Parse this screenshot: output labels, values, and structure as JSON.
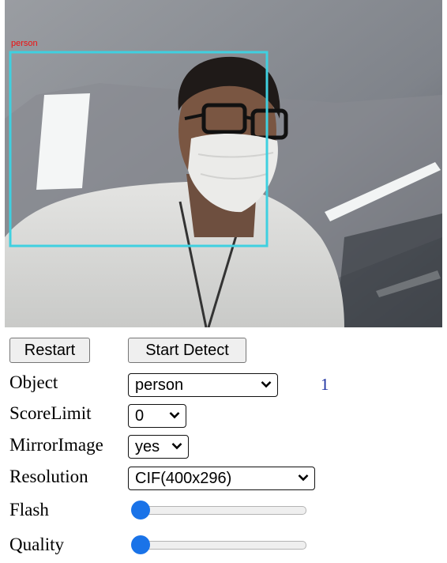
{
  "detection": {
    "label": "person"
  },
  "buttons": {
    "restart": "Restart",
    "start_detect": "Start Detect"
  },
  "object": {
    "label": "Object",
    "value": "person",
    "count": "1"
  },
  "score_limit": {
    "label": "ScoreLimit",
    "value": "0"
  },
  "mirror_image": {
    "label": "MirrorImage",
    "value": "yes"
  },
  "resolution": {
    "label": "Resolution",
    "value": "CIF(400x296)"
  },
  "flash": {
    "label": "Flash",
    "level": 0
  },
  "quality": {
    "label": "Quality",
    "level": 0
  },
  "colors": {
    "bbox": "#3fd0e0",
    "bbox_label": "#e11111",
    "slider_accent": "#1a73e8",
    "count_text": "#1a2fa0"
  }
}
